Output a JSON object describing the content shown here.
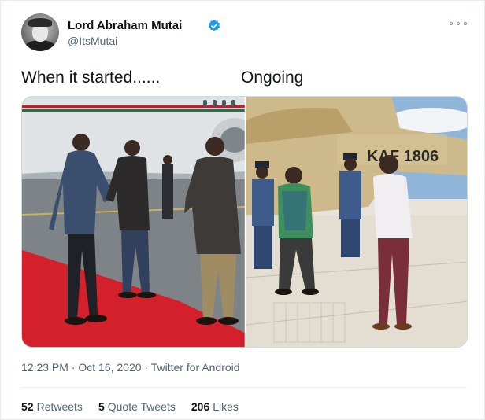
{
  "author": {
    "display_name": "Lord Abraham Mutai",
    "handle": "@ItsMutai",
    "verified": true
  },
  "tweet": {
    "text_left": "When it started......",
    "text_right": "Ongoing",
    "timestamp": "12:23 PM · Oct 16, 2020 · Twitter for Android"
  },
  "media": {
    "right_plane_text": "KAF 1806"
  },
  "stats": {
    "retweets_count": "52",
    "retweets_label": "Retweets",
    "quotes_count": "5",
    "quotes_label": "Quote Tweets",
    "likes_count": "206",
    "likes_label": "Likes"
  },
  "colors": {
    "verified_blue": "#1d9bf0",
    "text_primary": "#0f1419",
    "text_secondary": "#536471",
    "carpet_red": "#d3202a"
  }
}
